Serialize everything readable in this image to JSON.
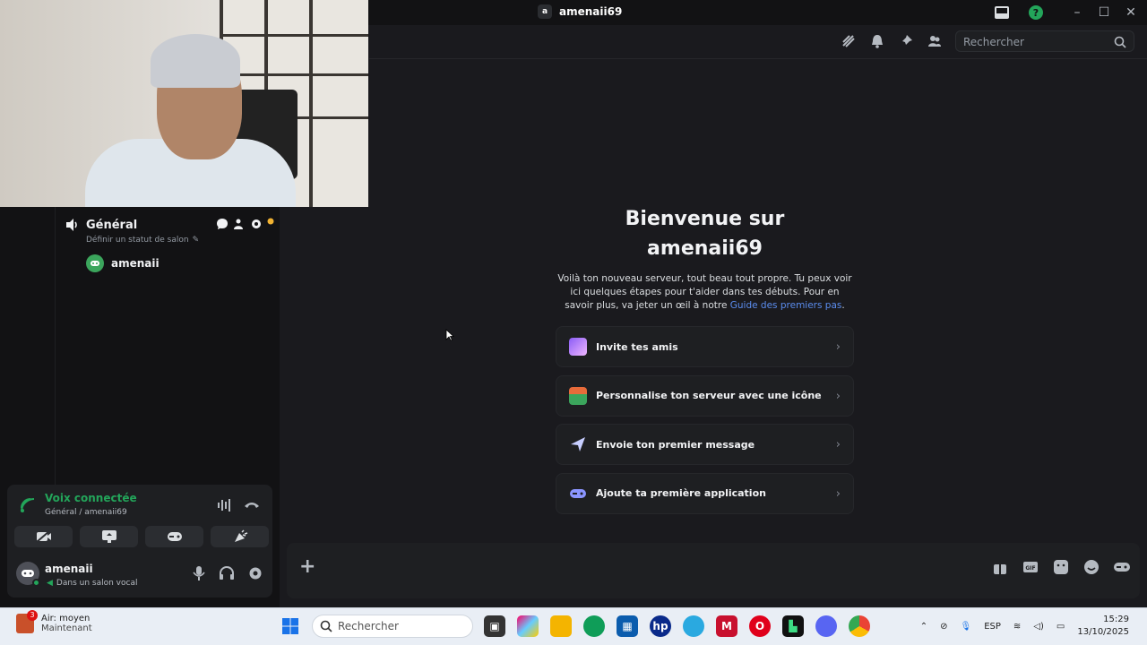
{
  "window": {
    "server_badge": "a",
    "server_name": "amenaii69"
  },
  "header": {
    "search_placeholder": "Rechercher"
  },
  "voice_channel": {
    "name": "Général",
    "status_placeholder": "Définir un statut de salon",
    "members": [
      {
        "name": "amenaii"
      }
    ]
  },
  "voice_panel": {
    "title": "Voix connectée",
    "subtitle": "Général / amenaii69"
  },
  "user_panel": {
    "username": "amenaii",
    "status": "Dans un salon vocal"
  },
  "welcome": {
    "title_line1": "Bienvenue sur",
    "title_line2": "amenaii69",
    "desc": "Voilà ton nouveau serveur, tout beau tout propre. Tu peux voir ici quelques étapes pour t'aider dans tes débuts. Pour en savoir plus, va jeter un œil à notre ",
    "link": "Guide des premiers pas",
    "desc_end": "."
  },
  "actions": [
    {
      "label": "Invite tes amis",
      "color": "#8a5cf6"
    },
    {
      "label": "Personnalise ton serveur avec une icône",
      "color": "#3ba55c"
    },
    {
      "label": "Envoie ton premier message",
      "color": "#b9c3ff"
    },
    {
      "label": "Ajoute ta première application",
      "color": "#7c8cff"
    }
  ],
  "taskbar": {
    "weather_title": "Air: moyen",
    "weather_sub": "Maintenant",
    "weather_badge": "3",
    "search_placeholder": "Rechercher",
    "lang": "ESP",
    "time": "15:29",
    "date": "13/10/2025"
  },
  "colors": {
    "accent": "#5865f2",
    "voice_green": "#23a55a",
    "link": "#5b8def"
  }
}
